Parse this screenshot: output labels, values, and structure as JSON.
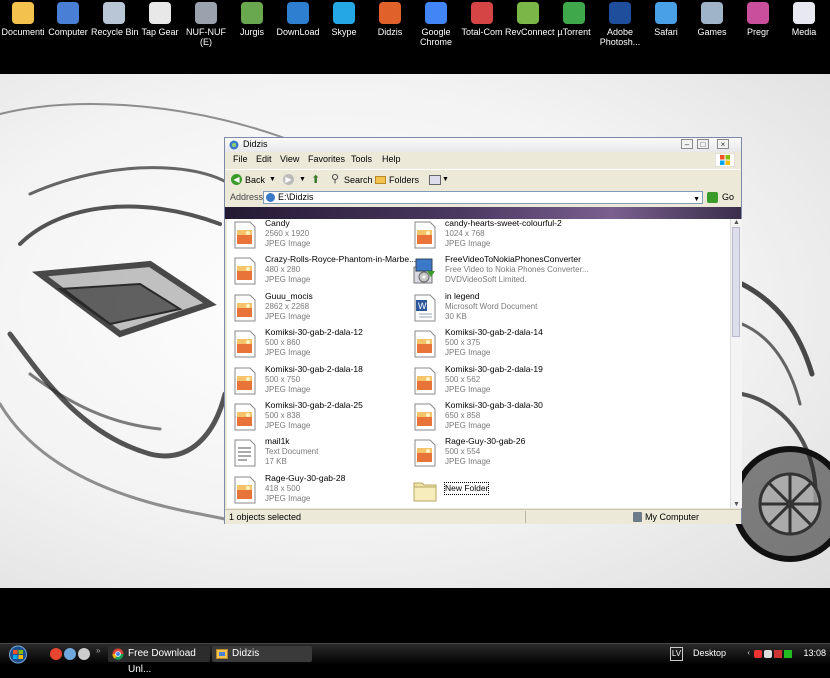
{
  "desktop_icons": [
    {
      "label": "Documenti",
      "label2": "",
      "icon": "folder-documents-icon",
      "color": "#f2c14e"
    },
    {
      "label": "Computer",
      "label2": "",
      "icon": "computer-icon",
      "color": "#4a7fd6"
    },
    {
      "label": "Recycle Bin",
      "label2": "",
      "icon": "recycle-bin-icon",
      "color": "#b9c6d6"
    },
    {
      "label": "Tap Gear",
      "label2": "",
      "icon": "tap-gear-icon",
      "color": "#e8e8e8"
    },
    {
      "label": "NUF-NUF",
      "label2": "(E)",
      "icon": "drive-icon",
      "color": "#9aa3ad"
    },
    {
      "label": "Jurgis",
      "label2": "",
      "icon": "jurgis-icon",
      "color": "#6aa84f"
    },
    {
      "label": "DownLoad",
      "label2": "",
      "icon": "download-globe-icon",
      "color": "#2f7fd1"
    },
    {
      "label": "Skype",
      "label2": "",
      "icon": "skype-icon",
      "color": "#25a7e5"
    },
    {
      "label": "Didzis",
      "label2": "",
      "icon": "windows-folder-icon",
      "color": "#e0622a"
    },
    {
      "label": "Google",
      "label2": "Chrome",
      "icon": "google-chrome-icon",
      "color": "#4285f4"
    },
    {
      "label": "Total-Com",
      "label2": "",
      "icon": "total-commander-icon",
      "color": "#d64545"
    },
    {
      "label": "RevConnect",
      "label2": "",
      "icon": "revconnect-icon",
      "color": "#7ab648"
    },
    {
      "label": "µTorrent",
      "label2": "",
      "icon": "utorrent-icon",
      "color": "#3fa84a"
    },
    {
      "label": "Adobe",
      "label2": "Photosh...",
      "icon": "photoshop-icon",
      "color": "#1f4e9c"
    },
    {
      "label": "Safari",
      "label2": "",
      "icon": "safari-icon",
      "color": "#4aa0e6"
    },
    {
      "label": "Games",
      "label2": "",
      "icon": "games-icon",
      "color": "#a0b4c8"
    },
    {
      "label": "Pregr",
      "label2": "",
      "icon": "programs-icon",
      "color": "#c94f9c"
    },
    {
      "label": "Media",
      "label2": "",
      "icon": "media-icon",
      "color": "#e8e8f0"
    }
  ],
  "window": {
    "title": "Didzis",
    "menu": [
      "File",
      "Edit",
      "View",
      "Favorites",
      "Tools",
      "Help"
    ],
    "toolbar": {
      "back": "Back",
      "search": "Search",
      "folders": "Folders"
    },
    "address_label": "Address",
    "address_value": "E:\\Didzis",
    "go_label": "Go",
    "status_left": "1 objects selected",
    "status_right": "My Computer"
  },
  "files": [
    {
      "name": "Candy",
      "line1": "2560 x 1920",
      "line2": "JPEG Image",
      "kind": "jpeg"
    },
    {
      "name": "candy-hearts-sweet-colourful-2",
      "line1": "1024 x 768",
      "line2": "JPEG Image",
      "kind": "jpeg"
    },
    {
      "name": "Crazy-Rolls-Royce-Phantom-in-Marbe...",
      "line1": "480 x 280",
      "line2": "JPEG Image",
      "kind": "jpeg"
    },
    {
      "name": "FreeVideoToNokiaPhonesConverter",
      "line1": "Free Video to Nokia Phones Converter...",
      "line2": "DVDVideoSoft Limited.",
      "kind": "installer"
    },
    {
      "name": "Guuu_mocis",
      "line1": "2862 x 2268",
      "line2": "JPEG Image",
      "kind": "jpeg"
    },
    {
      "name": "in legend",
      "line1": "Microsoft Word Document",
      "line2": "30 KB",
      "kind": "word"
    },
    {
      "name": "Komiksi-30-gab-2-dala-12",
      "line1": "500 x 860",
      "line2": "JPEG Image",
      "kind": "jpeg"
    },
    {
      "name": "Komiksi-30-gab-2-dala-14",
      "line1": "500 x 375",
      "line2": "JPEG Image",
      "kind": "jpeg"
    },
    {
      "name": "Komiksi-30-gab-2-dala-18",
      "line1": "500 x 750",
      "line2": "JPEG Image",
      "kind": "jpeg"
    },
    {
      "name": "Komiksi-30-gab-2-dala-19",
      "line1": "500 x 562",
      "line2": "JPEG Image",
      "kind": "jpeg"
    },
    {
      "name": "Komiksi-30-gab-2-dala-25",
      "line1": "500 x 838",
      "line2": "JPEG Image",
      "kind": "jpeg"
    },
    {
      "name": "Komiksi-30-gab-3-dala-30",
      "line1": "650 x 858",
      "line2": "JPEG Image",
      "kind": "jpeg"
    },
    {
      "name": "mail1k",
      "line1": "Text Document",
      "line2": "17 KB",
      "kind": "text"
    },
    {
      "name": "Rage-Guy-30-gab-26",
      "line1": "500 x 554",
      "line2": "JPEG Image",
      "kind": "jpeg"
    },
    {
      "name": "Rage-Guy-30-gab-28",
      "line1": "418 x 500",
      "line2": "JPEG Image",
      "kind": "jpeg"
    },
    {
      "name": "New Folder",
      "line1": "",
      "line2": "",
      "kind": "folder",
      "selected": true
    }
  ],
  "taskbar": {
    "tasks": [
      {
        "label": "Free Download Unl...",
        "icon": "chrome-icon"
      },
      {
        "label": "Didzis",
        "icon": "explorer-window-icon"
      }
    ],
    "tray": {
      "desktop_label": "Desktop",
      "lang": "LV",
      "clock": "13:08"
    }
  }
}
